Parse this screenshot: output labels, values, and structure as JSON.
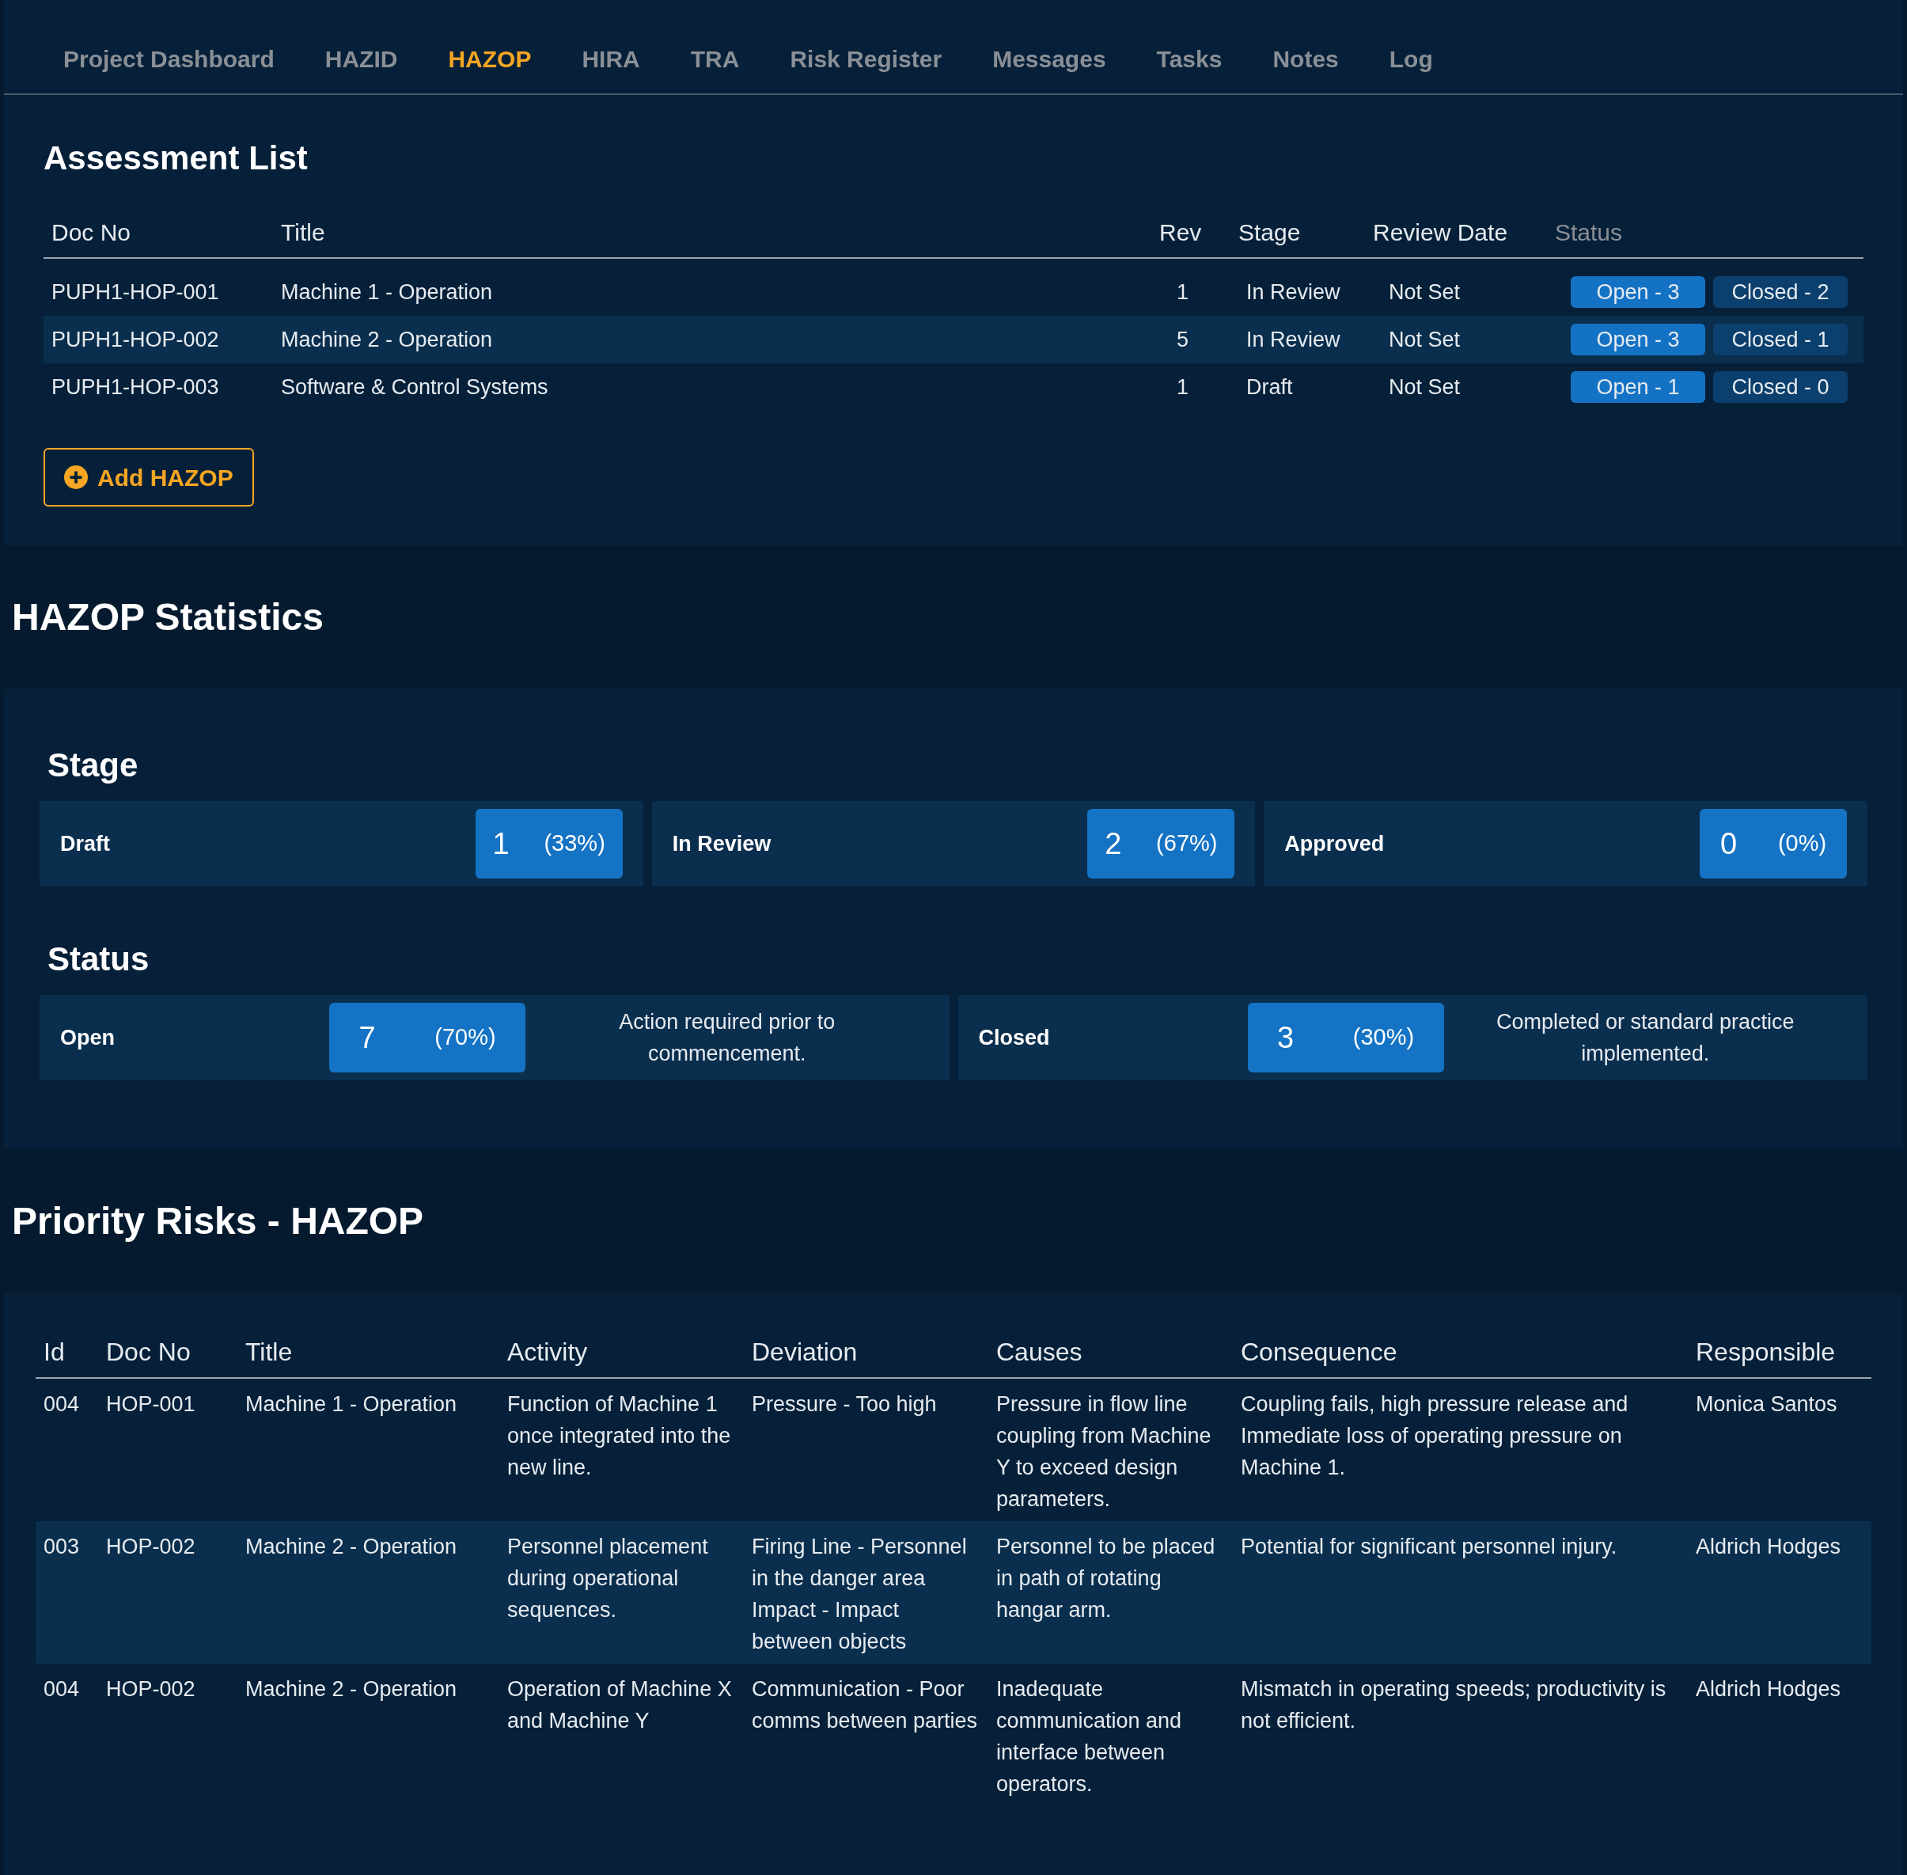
{
  "tabs": [
    {
      "label": "Project Dashboard",
      "selected": false
    },
    {
      "label": "HAZID",
      "selected": false
    },
    {
      "label": "HAZOP",
      "selected": true
    },
    {
      "label": "HIRA",
      "selected": false
    },
    {
      "label": "TRA",
      "selected": false
    },
    {
      "label": "Risk Register",
      "selected": false
    },
    {
      "label": "Messages",
      "selected": false
    },
    {
      "label": "Tasks",
      "selected": false
    },
    {
      "label": "Notes",
      "selected": false
    },
    {
      "label": "Log",
      "selected": false
    }
  ],
  "assessment_list": {
    "title": "Assessment List",
    "columns": [
      {
        "label": "Doc No",
        "muted": false
      },
      {
        "label": "Title",
        "muted": false
      },
      {
        "label": "Rev",
        "muted": false
      },
      {
        "label": "Stage",
        "muted": false
      },
      {
        "label": "Review Date",
        "muted": false
      },
      {
        "label": "Status",
        "muted": true
      }
    ],
    "rows": [
      {
        "doc_no": "PUPH1-HOP-001",
        "title": "Machine 1 - Operation",
        "rev": "1",
        "stage": "In Review",
        "review_date": "Not Set",
        "open": "Open - 3",
        "closed": "Closed - 2"
      },
      {
        "doc_no": "PUPH1-HOP-002",
        "title": "Machine 2 - Operation",
        "rev": "5",
        "stage": "In Review",
        "review_date": "Not Set",
        "open": "Open - 3",
        "closed": "Closed - 1"
      },
      {
        "doc_no": "PUPH1-HOP-003",
        "title": "Software & Control Systems",
        "rev": "1",
        "stage": "Draft",
        "review_date": "Not Set",
        "open": "Open - 1",
        "closed": "Closed - 0"
      }
    ],
    "add_button": "Add HAZOP"
  },
  "statistics": {
    "title": "HAZOP Statistics",
    "stage": {
      "title": "Stage",
      "cards": [
        {
          "label": "Draft",
          "value": "1",
          "percent": "(33%)"
        },
        {
          "label": "In Review",
          "value": "2",
          "percent": "(67%)"
        },
        {
          "label": "Approved",
          "value": "0",
          "percent": "(0%)"
        }
      ]
    },
    "status": {
      "title": "Status",
      "cards": [
        {
          "label": "Open",
          "value": "7",
          "percent": "(70%)",
          "description": "Action required prior to commencement."
        },
        {
          "label": "Closed",
          "value": "3",
          "percent": "(30%)",
          "description": "Completed or standard practice implemented."
        }
      ]
    }
  },
  "priority_risks": {
    "title": "Priority Risks - HAZOP",
    "columns": [
      "Id",
      "Doc No",
      "Title",
      "Activity",
      "Deviation",
      "Causes",
      "Consequence",
      "Responsible"
    ],
    "rows": [
      {
        "cells": [
          "004",
          "HOP-001",
          "Machine 1 - Operation",
          "Function of Machine 1 once integrated into the new line.",
          "Pressure - Too high",
          "Pressure in flow line coupling from Machine Y to exceed design parameters.",
          "Coupling fails, high pressure release and Immediate loss of operating pressure on Machine 1.",
          "Monica Santos"
        ]
      },
      {
        "cells": [
          "003",
          "HOP-002",
          "Machine 2 - Operation",
          "Personnel placement during operational sequences.",
          "Firing Line - Personnel in the danger area Impact - Impact between objects",
          "Personnel to be placed in path of rotating hangar arm.",
          "Potential for significant personnel injury.",
          "Aldrich Hodges"
        ]
      },
      {
        "cells": [
          "004",
          "HOP-002",
          "Machine 2 - Operation",
          "Operation of Machine X and Machine Y",
          "Communication - Poor comms between parties",
          "Inadequate communication and interface between operators.",
          "Mismatch in operating speeds; productivity is not efficient.",
          "Aldrich Hodges"
        ]
      }
    ]
  }
}
